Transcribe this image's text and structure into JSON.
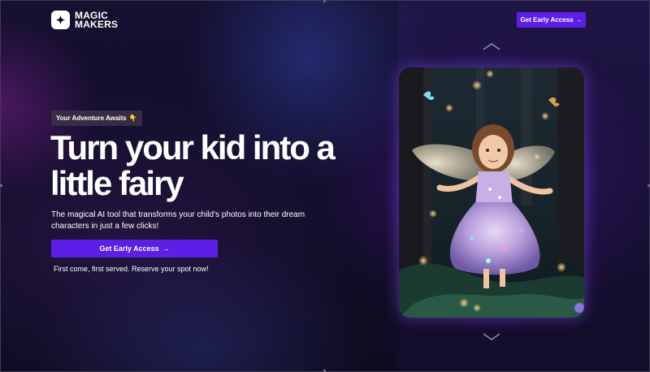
{
  "header": {
    "logo_line1": "MAGIC",
    "logo_line2": "MAKERS",
    "cta_label": "Get Early Access",
    "cta_arrow": "→"
  },
  "hero": {
    "badge_text": "Your Adventure Awaits",
    "badge_emoji": "👇",
    "title": "Turn your kid into a little fairy",
    "description": "The magical AI tool that transforms your child's photos into their dream characters in just a few clicks!",
    "cta_label": "Get Early Access",
    "cta_arrow": "→",
    "note": "First come, first served. Reserve your spot now!"
  },
  "carousel": {
    "prev_icon": "chevron-up-icon",
    "next_icon": "chevron-down-icon",
    "image_subject": "little girl in a sparkly fairy costume with wings in an enchanted forest"
  },
  "colors": {
    "accent": "#5b1fe6",
    "background": "#130e29",
    "text": "#ffffff"
  }
}
